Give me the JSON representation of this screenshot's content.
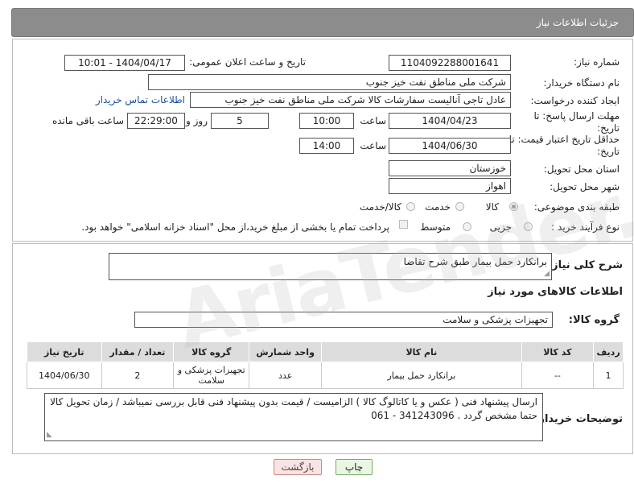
{
  "header": {
    "title": "جزئیات اطلاعات نیاز"
  },
  "form": {
    "need_number_label": "شماره نیاز:",
    "need_number": "1104092288001641",
    "announce_label": "تاریخ و ساعت اعلان عمومی:",
    "announce_value": "1404/04/17 - 10:01",
    "buyer_org_label": "نام دستگاه خریدار:",
    "buyer_org": "شرکت ملی مناطق نفت خیز جنوب",
    "requester_label": "ایجاد کننده درخواست:",
    "requester": "عادل  تاجی آنالیست سفارشات کالا  شرکت ملی مناطق نفت خیز جنوب",
    "contact_link": "اطلاعات تماس خریدار",
    "deadline_label": "مهلت ارسال پاسخ: تا تاریخ:",
    "deadline_date": "1404/04/23",
    "time_label": "ساعت",
    "deadline_time": "10:00",
    "days": "5",
    "days_label": "روز و",
    "remaining_time": "22:29:00",
    "remaining_label": "ساعت باقی مانده",
    "validity_label": "حداقل تاریخ اعتبار قیمت: تا تاریخ:",
    "validity_date": "1404/06/30",
    "validity_time_label": "ساعت",
    "validity_time": "14:00",
    "province_label": "استان محل تحویل:",
    "province": "خوزستان",
    "city_label": "شهر محل تحویل:",
    "city": "اهواز",
    "category_label": "طبقه بندی موضوعی:",
    "category_options": [
      "کالا",
      "خدمت",
      "کالا/خدمت"
    ],
    "process_label": "نوع فرآیند خرید :",
    "process_options": [
      "جزیی",
      "متوسط"
    ],
    "payment_note": "پرداخت تمام یا بخشی از مبلغ خرید،از محل \"اسناد خزانه اسلامی\" خواهد بود."
  },
  "details": {
    "summary_label": "شرح کلی نیاز:",
    "summary": "برانکارد حمل بیمار طبق شرح تقاضا",
    "items_heading": "اطلاعات کالاهای مورد نیاز",
    "group_label": "گروه کالا:",
    "group_value": "تجهیزات پزشکی و سلامت",
    "table_headers": [
      "ردیف",
      "کد کالا",
      "نام کالا",
      "واحد شمارش",
      "گروه کالا",
      "تعداد / مقدار",
      "تاریخ نیاز"
    ],
    "rows": [
      [
        "1",
        "--",
        "برانکارد حمل بیمار",
        "عدد",
        "تجهیزات پزشکی و سلامت",
        "2",
        "1404/06/30"
      ]
    ],
    "buyer_notes_label": "توضیحات خریدار:",
    "buyer_notes": "ارسال پیشنهاد فنی ( عکس و یا کاتالوگ کالا ) الزامیست  / قیمت بدون پیشنهاد فنی قابل بررسی نمیباشد / زمان تحویل کالا حتما مشخص گردد . 341243096 - 061"
  },
  "buttons": {
    "print": "چاپ",
    "back": "بازگشت"
  }
}
